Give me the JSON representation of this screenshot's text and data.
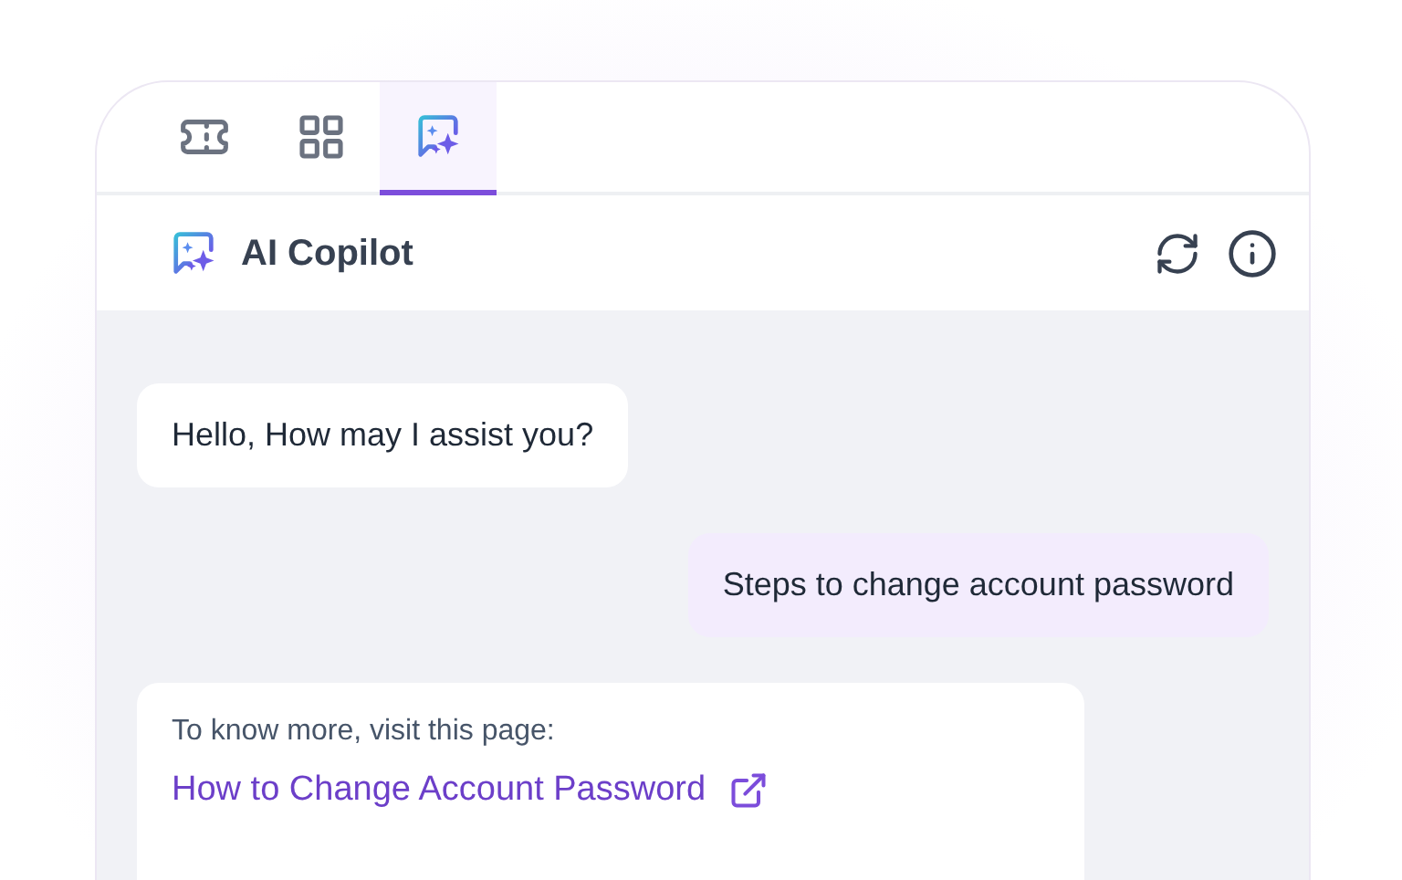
{
  "tabs": [
    {
      "kind": "ticket",
      "selected": false
    },
    {
      "kind": "apps",
      "selected": false
    },
    {
      "kind": "copilot",
      "selected": true
    }
  ],
  "header": {
    "title": "AI Copilot"
  },
  "messages": [
    {
      "kind": "bot",
      "text": "Hello, How may I assist you?"
    },
    {
      "kind": "user",
      "text": "Steps to change account password"
    },
    {
      "kind": "bot_link",
      "intro": "To know more, visit this page:",
      "link": "How to Change Account Password"
    }
  ]
}
